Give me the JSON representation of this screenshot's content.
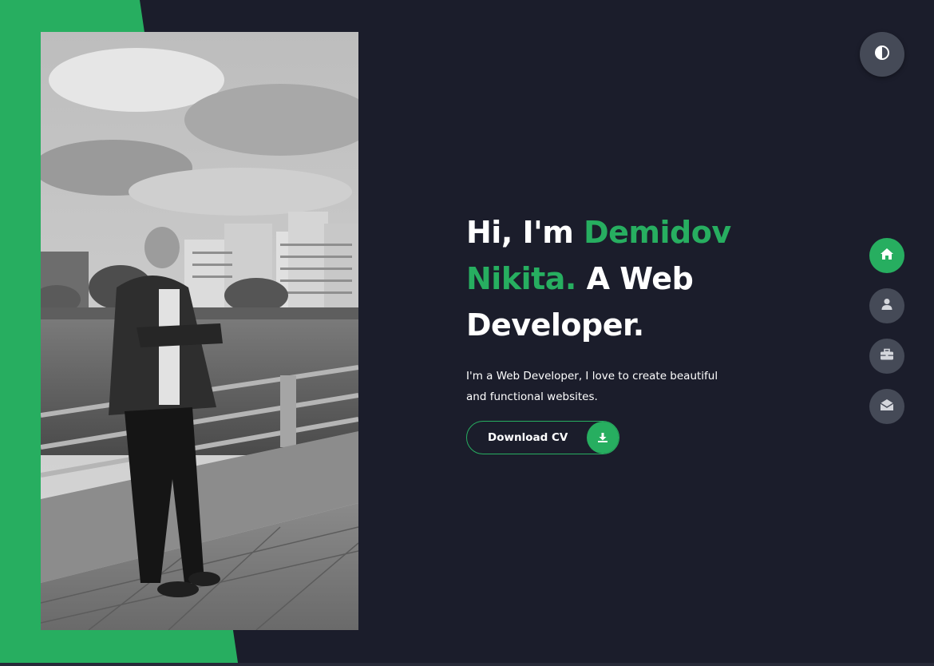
{
  "hero": {
    "title_part1": "Hi, I'm ",
    "title_name": "Demidov Nikita.",
    "title_part2": " A Web Developer.",
    "description": "I'm a Web Developer, I love to create beautiful and functional websites."
  },
  "cv_button": {
    "label": "Download CV",
    "icon": "download-icon"
  },
  "theme_toggle": {
    "icon": "contrast-icon"
  },
  "nav": [
    {
      "id": "home",
      "icon": "home-icon",
      "active": true
    },
    {
      "id": "about",
      "icon": "user-icon",
      "active": false
    },
    {
      "id": "portfolio",
      "icon": "briefcase-icon",
      "active": false
    },
    {
      "id": "contact",
      "icon": "envelope-open-icon",
      "active": false
    }
  ],
  "colors": {
    "background": "#1b1d2b",
    "accent": "#27ae60",
    "button_gray": "#454a57",
    "text": "#ffffff"
  }
}
